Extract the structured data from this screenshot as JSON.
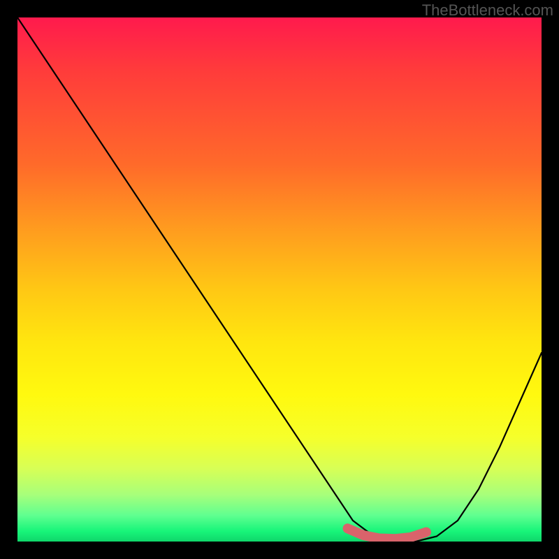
{
  "watermark": "TheBottleneck.com",
  "chart_data": {
    "type": "line",
    "title": "",
    "xlabel": "",
    "ylabel": "",
    "xlim": [
      0,
      100
    ],
    "ylim": [
      0,
      100
    ],
    "series": [
      {
        "name": "bottleneck-curve",
        "x": [
          0,
          8,
          16,
          24,
          32,
          40,
          48,
          56,
          60,
          64,
          68,
          72,
          76,
          80,
          84,
          88,
          92,
          96,
          100
        ],
        "values": [
          100,
          88,
          76,
          64,
          52,
          40,
          28,
          16,
          10,
          4,
          1,
          0,
          0,
          1,
          4,
          10,
          18,
          27,
          36
        ]
      },
      {
        "name": "optimal-zone",
        "x": [
          63,
          66,
          69,
          72,
          75,
          78
        ],
        "values": [
          2.5,
          1.2,
          0.6,
          0.5,
          0.8,
          1.8
        ]
      }
    ],
    "gradient_stops": [
      {
        "pos": 0,
        "color": "#ff1a4d"
      },
      {
        "pos": 10,
        "color": "#ff3b3b"
      },
      {
        "pos": 28,
        "color": "#ff6a2a"
      },
      {
        "pos": 40,
        "color": "#ff9a1f"
      },
      {
        "pos": 52,
        "color": "#ffc814"
      },
      {
        "pos": 62,
        "color": "#ffe60f"
      },
      {
        "pos": 72,
        "color": "#fff90f"
      },
      {
        "pos": 80,
        "color": "#f6ff2a"
      },
      {
        "pos": 86,
        "color": "#d8ff55"
      },
      {
        "pos": 91,
        "color": "#a8ff7a"
      },
      {
        "pos": 95,
        "color": "#60ff90"
      },
      {
        "pos": 98,
        "color": "#18f57a"
      },
      {
        "pos": 100,
        "color": "#0fd66a"
      }
    ]
  }
}
